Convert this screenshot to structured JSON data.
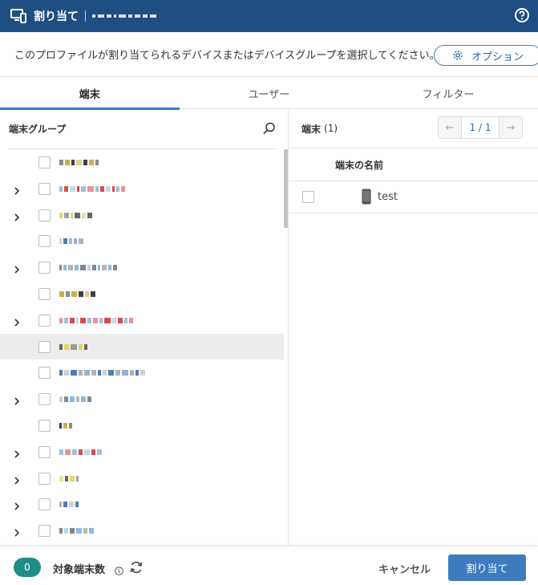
{
  "header": {
    "title": "割り当て",
    "help_icon": "question-circle-icon",
    "profile_icon": "devices-icon"
  },
  "description": {
    "text": "このプロファイルが割り当てられるデバイスまたはデバイスグループを選択してください。",
    "option_label": "オプション"
  },
  "tabs": [
    {
      "label": "端末",
      "active": true
    },
    {
      "label": "ユーザー",
      "active": false
    },
    {
      "label": "フィルター",
      "active": false
    }
  ],
  "left_panel": {
    "title": "端末グループ",
    "rows": [
      {
        "expandable": false,
        "highlighted": false
      },
      {
        "expandable": true,
        "highlighted": false
      },
      {
        "expandable": true,
        "highlighted": false
      },
      {
        "expandable": false,
        "highlighted": false
      },
      {
        "expandable": true,
        "highlighted": false
      },
      {
        "expandable": false,
        "highlighted": false
      },
      {
        "expandable": true,
        "highlighted": false
      },
      {
        "expandable": false,
        "highlighted": true
      },
      {
        "expandable": false,
        "highlighted": false
      },
      {
        "expandable": true,
        "highlighted": false
      },
      {
        "expandable": false,
        "highlighted": false
      },
      {
        "expandable": true,
        "highlighted": false
      },
      {
        "expandable": true,
        "highlighted": false
      },
      {
        "expandable": true,
        "highlighted": false
      },
      {
        "expandable": true,
        "highlighted": false
      }
    ]
  },
  "right_panel": {
    "title": "端末",
    "count": "(1)",
    "pager": {
      "prev": "←",
      "page": "1 / 1",
      "next": "→"
    },
    "column_header": "端末の名前",
    "devices": [
      {
        "name": "test",
        "icon": "smartphone-icon"
      }
    ]
  },
  "footer": {
    "count": "0",
    "target_label": "対象端末数",
    "cancel_label": "キャンセル",
    "assign_label": "割り当て"
  },
  "colors": {
    "header_bg": "#1f4e82",
    "accent": "#3a7bc8",
    "badge": "#1e8e8a",
    "assign_button": "#3e7cbf"
  }
}
